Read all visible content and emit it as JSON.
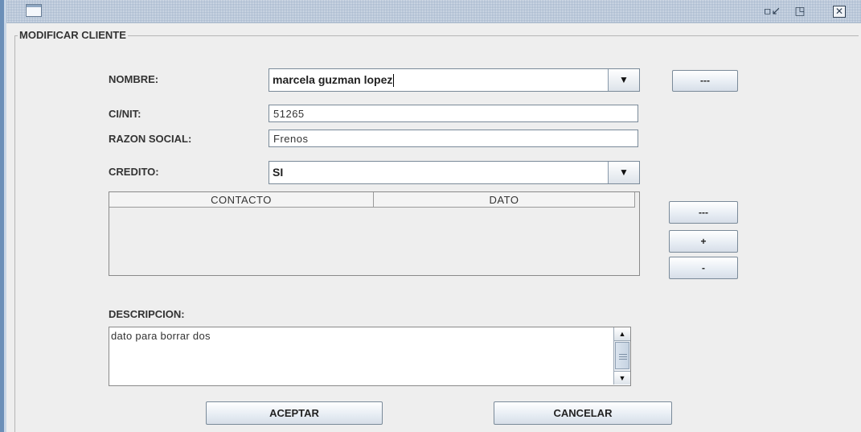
{
  "window": {
    "minimize_icon": "minimize-icon",
    "maximize_icon": "maximize-icon",
    "close_icon": "close-icon",
    "minimize_glyph": "▫↙",
    "maximize_glyph": "◳",
    "close_glyph": "✕"
  },
  "group": {
    "title": "MODIFICAR CLIENTE"
  },
  "form": {
    "nombre_label": "NOMBRE:",
    "nombre_value": "marcela guzman lopez",
    "nombre_button": "---",
    "ci_label": "CI/NIT:",
    "ci_value": "51265",
    "razon_label": "RAZON SOCIAL:",
    "razon_value": "Frenos",
    "credito_label": "CREDITO:",
    "credito_value": "SI"
  },
  "table": {
    "columns": [
      "CONTACTO",
      "DATO"
    ],
    "rows": []
  },
  "side_buttons": {
    "more": "---",
    "add": "+",
    "remove": "-"
  },
  "descripcion": {
    "label": "DESCRIPCION:",
    "value": "dato para borrar dos"
  },
  "actions": {
    "accept": "ACEPTAR",
    "cancel": "CANCELAR"
  },
  "colors": {
    "accent": "#6b8fb8",
    "background": "#eeeeee"
  }
}
